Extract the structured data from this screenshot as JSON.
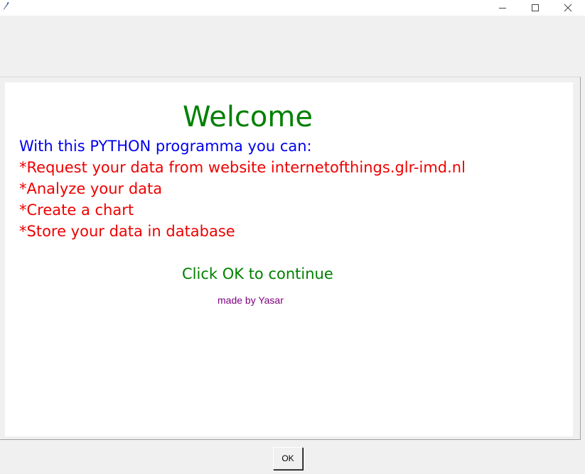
{
  "window": {
    "icon": "feather-icon",
    "controls": {
      "minimize_icon": "minimize-icon",
      "maximize_icon": "maximize-icon",
      "close_icon": "close-icon"
    }
  },
  "content": {
    "welcome": "Welcome",
    "intro": "With this PYTHON programma you can:",
    "features": [
      "*Request your data from website internetofthings.glr-imd.nl",
      "*Analyze your data",
      "*Create a chart",
      "*Store your data in database"
    ],
    "cta": "Click OK to continue",
    "credit": "made by Yasar"
  },
  "buttons": {
    "ok_label": "OK"
  },
  "colors": {
    "welcome": "#008000",
    "intro": "#0000ee",
    "features": "#ee0000",
    "cta": "#008000",
    "credit": "#800080"
  }
}
